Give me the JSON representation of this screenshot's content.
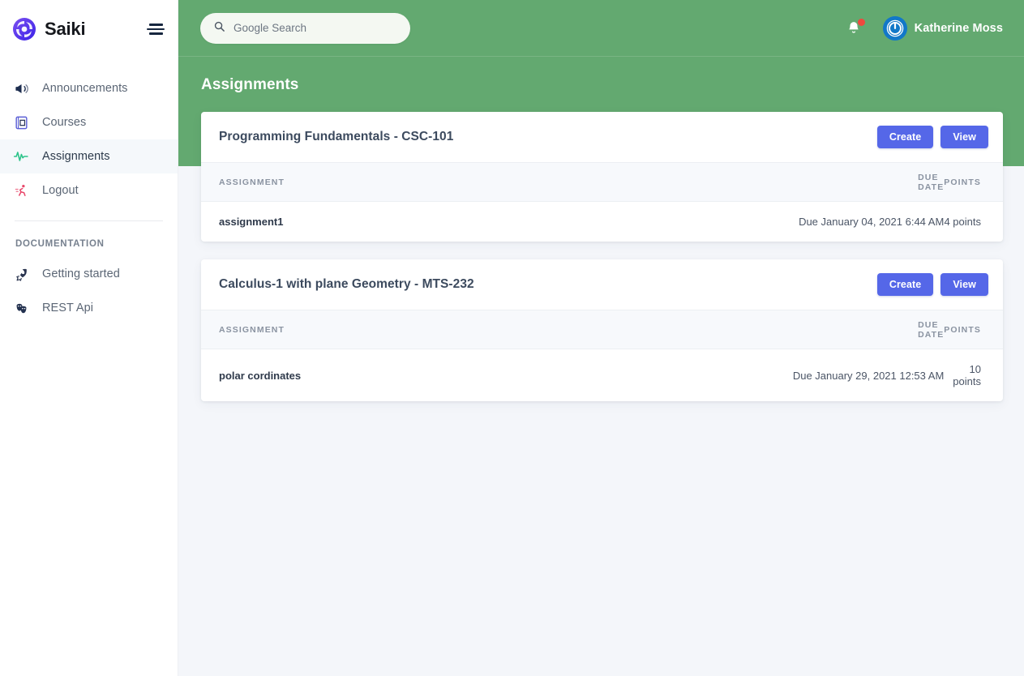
{
  "brand": {
    "name": "Saiki",
    "logo_icon": "saiki-spiral-logo",
    "menu_icon": "hamburger-icon"
  },
  "sidebar": {
    "items": [
      {
        "label": "Announcements",
        "icon": "megaphone-icon",
        "active": false
      },
      {
        "label": "Courses",
        "icon": "book-icon",
        "active": false
      },
      {
        "label": "Assignments",
        "icon": "activity-pulse-icon",
        "active": true
      },
      {
        "label": "Logout",
        "icon": "running-person-icon",
        "active": false
      }
    ],
    "section_label": "DOCUMENTATION",
    "doc_items": [
      {
        "label": "Getting started",
        "icon": "rocket-icon"
      },
      {
        "label": "REST Api",
        "icon": "theater-masks-icon"
      }
    ]
  },
  "topbar": {
    "search_placeholder": "Google Search",
    "search_value": "",
    "search_icon": "search-icon",
    "bell_icon": "bell-icon",
    "bell_has_badge": true,
    "avatar_icon": "power-circle-avatar",
    "user_name": "Katherine Moss"
  },
  "page": {
    "title": "Assignments"
  },
  "table_headers": {
    "assignment": "ASSIGNMENT",
    "due_date": "DUE DATE",
    "points": "POINTS"
  },
  "buttons": {
    "create": "Create",
    "view": "View"
  },
  "courses": [
    {
      "title": "Programming Fundamentals - CSC-101",
      "assignments": [
        {
          "name": "assignment1",
          "due": "Due January 04, 2021 6:44 AM",
          "points": "4 points"
        }
      ]
    },
    {
      "title": "Calculus-1 with plane Geometry - MTS-232",
      "assignments": [
        {
          "name": "polar cordinates",
          "due": "Due January 29, 2021 12:53 AM",
          "points": "10 points"
        }
      ]
    }
  ],
  "colors": {
    "banner_green": "#63a970",
    "button_blue": "#5567e8",
    "page_bg": "#f4f6fa",
    "sidebar_bg": "#ffffff",
    "notification_red": "#f0483e",
    "avatar_blue": "#1278c8"
  }
}
